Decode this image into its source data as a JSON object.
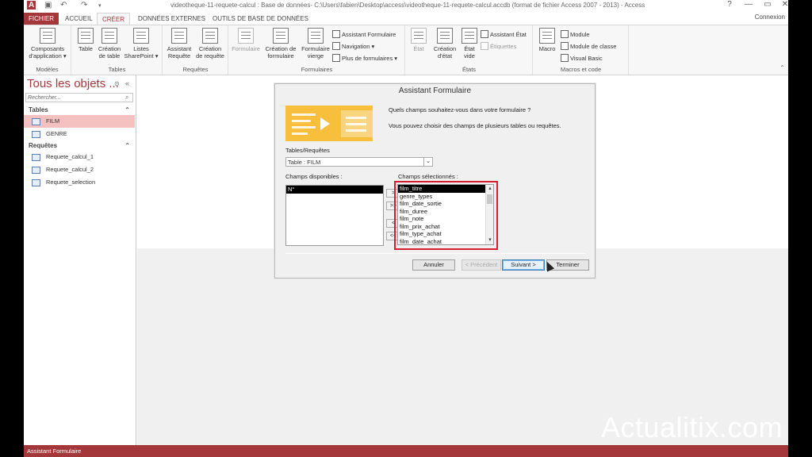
{
  "window": {
    "title": "videotheque-11-requete-calcul : Base de données- C:\\Users\\fabien\\Desktop\\access\\videotheque-11-requete-calcul.accdb (format de fichier Access 2007 - 2013) - Access",
    "app_icon": "A",
    "connexion": "Connexion",
    "help": "?",
    "minimize": "—",
    "restore": "▭",
    "close": "✕"
  },
  "tabs": [
    "FICHIER",
    "ACCUEIL",
    "CRÉER",
    "DONNÉES EXTERNES",
    "OUTILS DE BASE DE DONNÉES"
  ],
  "ribbon": {
    "modeles": {
      "label": "Modèles",
      "btn1": "Composants",
      "btn2": "d'application ▾"
    },
    "tables": {
      "label": "Tables",
      "table": "Table",
      "creation1": "Création",
      "creation2": "de table",
      "listes1": "Listes",
      "listes2": "SharePoint ▾"
    },
    "requetes": {
      "label": "Requêtes",
      "assistant1": "Assistant",
      "assistant2": "Requête",
      "creation1": "Création",
      "creation2": "de requête"
    },
    "formulaires": {
      "label": "Formulaires",
      "formulaire": "Formulaire",
      "creation1": "Création de",
      "creation2": "formulaire",
      "vierge1": "Formulaire",
      "vierge2": "vierge",
      "assistant": "Assistant Formulaire",
      "navigation": "Navigation ▾",
      "plus": "Plus de formulaires ▾"
    },
    "etats": {
      "label": "États",
      "etat": "État",
      "creation1": "Création",
      "creation2": "d'état",
      "vide1": "État",
      "vide2": "vide",
      "assistant": "Assistant État",
      "etiquettes": "Étiquettes"
    },
    "macros": {
      "label": "Macros et code",
      "macro": "Macro",
      "module": "Module",
      "module_classe": "Module de classe",
      "vb": "Visual Basic"
    }
  },
  "nav": {
    "title": "Tous les objets ...",
    "search_placeholder": "Rechercher...",
    "sections": [
      {
        "label": "Tables",
        "items": [
          "FILM",
          "GENRE"
        ]
      },
      {
        "label": "Requêtes",
        "items": [
          "Requete_calcul_1",
          "Requete_calcul_2",
          "Requete_selection"
        ]
      }
    ]
  },
  "dialog": {
    "title": "Assistant Formulaire",
    "question": "Quels champs souhaitez-vous dans votre formulaire ?",
    "hint": "Vous pouvez choisir des champs de plusieurs tables ou requêtes.",
    "tables_label": "Tables/Requêtes",
    "table_value": "Table : FILM",
    "avail_label": "Champs disponibles :",
    "chosen_label": "Champs sélectionnés :",
    "available": [
      "N°"
    ],
    "selected": [
      "film_titre",
      "genre_types",
      "film_date_sortie",
      "film_duree",
      "film_note",
      "film_prix_achat",
      "film_type_achat",
      "film_date_achat"
    ],
    "move_buttons": [
      ">",
      ">>",
      "<",
      "<<"
    ],
    "buttons": {
      "annuler": "Annuler",
      "precedent": "< Précédent",
      "suivant": "Suivant >",
      "terminer": "Terminer"
    }
  },
  "status": "Assistant Formulaire",
  "watermark": "Actualitix.com",
  "colors": {
    "accent": "#a4373a",
    "highlight": "#d4202e",
    "selection": "#f4c0c0"
  }
}
